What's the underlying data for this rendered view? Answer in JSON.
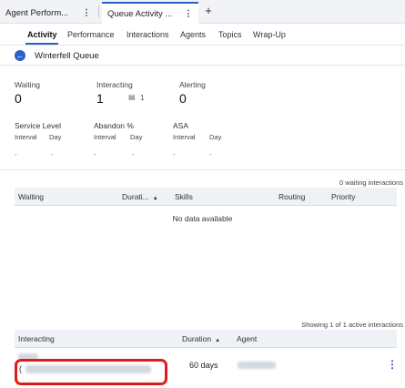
{
  "tabs": [
    {
      "label": "Agent Perform..."
    },
    {
      "label": "Queue Activity ..."
    }
  ],
  "add_tab_symbol": "+",
  "kebab_symbol": "⋮",
  "subnav": [
    "Activity",
    "Performance",
    "Interactions",
    "Agents",
    "Topics",
    "Wrap-Up"
  ],
  "queue_name": "Winterfell Queue",
  "stats": {
    "waiting": {
      "label": "Waiting",
      "value": "0"
    },
    "interacting": {
      "label": "Interacting",
      "value": "1",
      "mini_value": "1"
    },
    "alerting": {
      "label": "Alerting",
      "value": "0"
    }
  },
  "metrics": {
    "service_level": "Service Level",
    "abandon": "Abandon %",
    "asa": "ASA",
    "interval": "Interval",
    "day": "Day",
    "dash": "-"
  },
  "waiting_table": {
    "count_text": "0 waiting interactions",
    "columns": [
      "Waiting",
      "Durati...",
      "Skills",
      "Routing",
      "Priority"
    ],
    "empty_text": "No data available"
  },
  "interacting_table": {
    "count_text": "Showing 1 of 1 active interactions",
    "columns": [
      "Interacting",
      "Duration",
      "Agent"
    ],
    "rows": [
      {
        "paren": "(",
        "duration": "60 days"
      }
    ]
  },
  "icons": {
    "back": "arrow-left-icon",
    "sort": "sort-ascending-icon",
    "mini": "chat-icon"
  },
  "colors": {
    "accent": "#2a60c8",
    "highlight": "#e11b1b"
  }
}
